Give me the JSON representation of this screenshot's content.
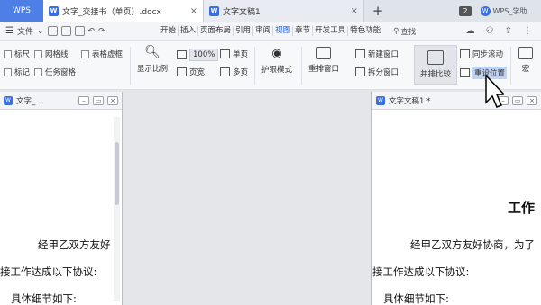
{
  "titlebar": {
    "app_button": "WPS",
    "tabs": [
      {
        "label": "文字_交接书（单页）.docx",
        "close": "×",
        "icon": "W"
      },
      {
        "label": "文字文稿1",
        "close": "×",
        "icon": "W"
      }
    ],
    "new_tab": "+",
    "window_count": "2",
    "account": "WPS_学助..."
  },
  "menubar": {
    "file_label": "文件",
    "tabs": [
      "开始",
      "插入",
      "页面布局",
      "引用",
      "审阅",
      "视图",
      "章节",
      "开发工具",
      "特色功能"
    ],
    "active_tab": "视图",
    "search_label": "查找"
  },
  "ribbon": {
    "checkboxes": [
      "标尺",
      "网格线",
      "表格虚框",
      "标记",
      "任务窗格"
    ],
    "display_ratio": "显示比例",
    "zoom_100": "100%",
    "page_width": "页宽",
    "single_page": "单页",
    "multi_page": "多页",
    "eye_mode": "护眼模式",
    "rearrange_window": "重排窗口",
    "new_window": "新建窗口",
    "split_window": "拆分窗口",
    "side_by_side": "并排比较",
    "sync_scroll": "同步滚动",
    "reset_position": "重设位置",
    "macro": "宏"
  },
  "left_window": {
    "title": "文字_...",
    "lines": [
      "经甲乙双方友好",
      "接工作达成以下协议:",
      "具体细节如下:"
    ]
  },
  "right_window": {
    "title": "文字文稿1 *",
    "heading": "工作",
    "lines": [
      "经甲乙双方友好协商，为了",
      "接工作达成以下协议:",
      "具体细节如下:"
    ]
  },
  "colors": {
    "accent": "#4d7fe6",
    "active_menu": "#1f5fe0"
  }
}
